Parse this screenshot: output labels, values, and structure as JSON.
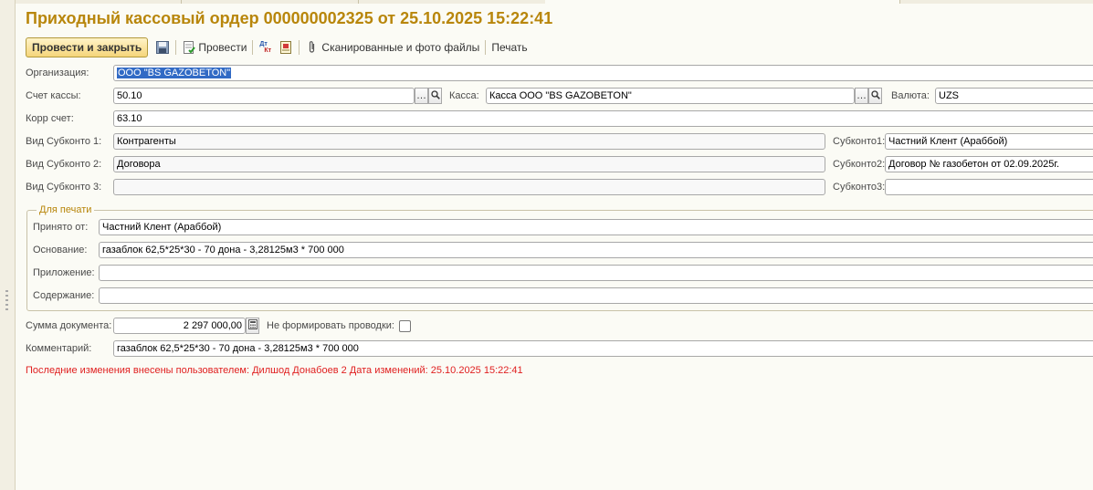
{
  "window": {
    "title": "Приходный кассовый ордер 000000002325 от 25.10.2025 15:22:41"
  },
  "toolbar": {
    "post_close": "Провести и закрыть",
    "post": "Провести",
    "scanned_files": "Сканированные и фото файлы",
    "print": "Печать",
    "dt_kt_top": "Дт",
    "dt_kt_bottom": "Кт"
  },
  "form": {
    "org_label": "Организация:",
    "org_value": "ООО \"BS GAZOBETON\"",
    "cash_account_label": "Счет кассы:",
    "cash_account_value": "50.10",
    "kassa_label": "Касса:",
    "kassa_value": "Касса ООО \"BS GAZOBETON\"",
    "currency_label": "Валюта:",
    "currency_value": "UZS",
    "corr_label": "Корр счет:",
    "corr_value": "63.10",
    "sub1_kind_label": "Вид Субконто 1:",
    "sub1_kind_value": "Контрагенты",
    "sub2_kind_label": "Вид Субконто 2:",
    "sub2_kind_value": "Договора",
    "sub3_kind_label": "Вид Субконто 3:",
    "sub3_kind_value": "",
    "sub1_label": "Субконто1:",
    "sub1_value": "Частний Клент (Араббой)",
    "sub2_label": "Субконто2:",
    "sub2_value": "Договор № газобетон от 02.09.2025г.",
    "sub3_label": "Субконто3:",
    "sub3_value": "",
    "print_group": "Для печати",
    "received_label": "Принято от:",
    "received_value": "Частний Клент (Араббой)",
    "basis_label": "Основание:",
    "basis_value": "газаблок 62,5*25*30 - 70 дона - 3,28125м3 * 700 000",
    "attachment_label": "Приложение:",
    "attachment_value": "",
    "content_label": "Содержание:",
    "content_value": "",
    "sum_label": "Сумма документа:",
    "sum_value": "2 297 000,00",
    "no_entries_label": "Не формировать проводки:",
    "comment_label": "Комментарий:",
    "comment_value": "газаблок 62,5*25*30 - 70 дона - 3,28125м3 * 700 000"
  },
  "status": {
    "last_change": "Последние изменения внесены пользователем: Дилшод Донабоев 2 Дата изменений: 25.10.2025 15:22:41"
  },
  "colors": {
    "title": "#b8860b",
    "status": "#e02020",
    "selection": "#316ac5",
    "button": "#f5d57a"
  }
}
